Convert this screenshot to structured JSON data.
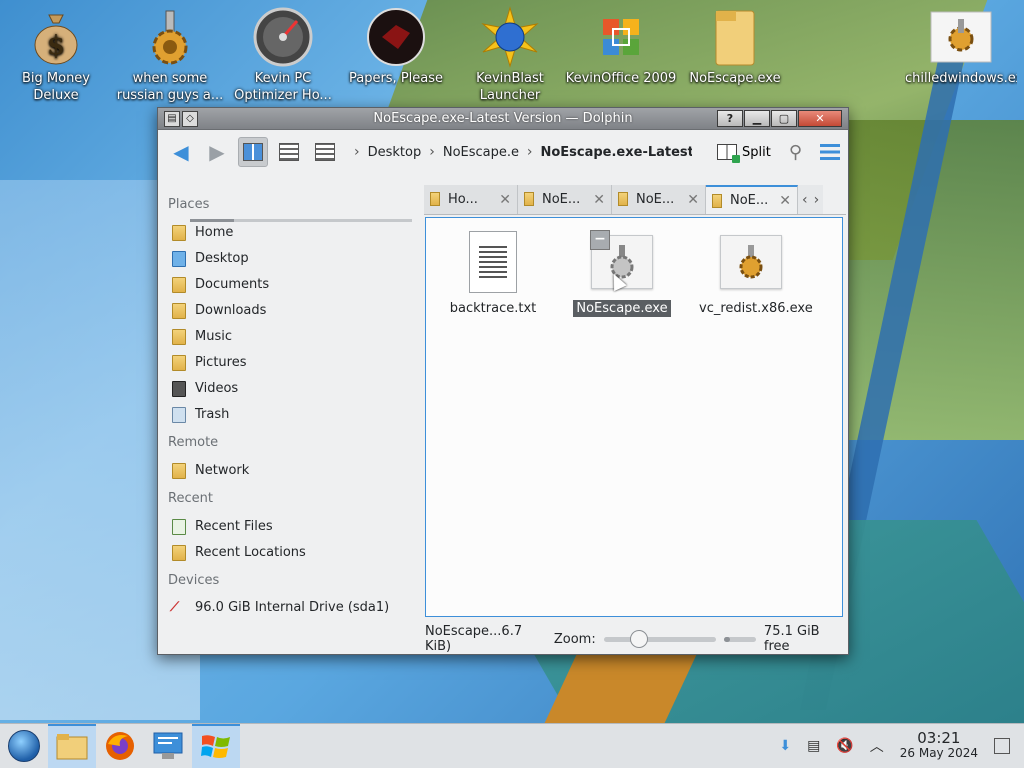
{
  "desktop": {
    "icons": [
      {
        "label": "Big Money Deluxe",
        "icon": "money-bag-icon"
      },
      {
        "label": "when some russian guys a...",
        "icon": "gear-icon"
      },
      {
        "label": "Kevin PC Optimizer Ho...",
        "icon": "speedometer-icon"
      },
      {
        "label": "Papers, Please",
        "icon": "papers-please-icon"
      },
      {
        "label": "KevinBlast Launcher",
        "icon": "globe-burst-icon"
      },
      {
        "label": "KevinOffice 2009",
        "icon": "office-logo-icon"
      },
      {
        "label": "NoEscape.exe",
        "icon": "folder-icon"
      },
      {
        "label": "chilledwindows.exe",
        "icon": "gear-icon"
      }
    ]
  },
  "window": {
    "title": "NoEscape.exe-Latest Version — Dolphin",
    "toolbar": {
      "breadcrumb": [
        "Desktop",
        "NoEscape.exe",
        "NoEscape.exe-Latest Version"
      ],
      "split_label": "Split"
    },
    "places": {
      "sections": {
        "places": "Places",
        "remote": "Remote",
        "recent": "Recent",
        "devices": "Devices"
      },
      "items": [
        "Home",
        "Desktop",
        "Documents",
        "Downloads",
        "Music",
        "Pictures",
        "Videos",
        "Trash"
      ],
      "remote": [
        "Network"
      ],
      "recent": [
        "Recent Files",
        "Recent Locations"
      ],
      "devices": [
        "96.0 GiB Internal Drive (sda1)"
      ]
    },
    "tabs": [
      {
        "label": "Ho..."
      },
      {
        "label": "NoE..."
      },
      {
        "label": "NoE..."
      },
      {
        "label": "NoE...",
        "active": true
      }
    ],
    "files": [
      {
        "name": "backtrace.txt",
        "icon": "text-file-icon",
        "selected": false
      },
      {
        "name": "NoEscape.exe",
        "icon": "gear-exe-icon",
        "selected": true
      },
      {
        "name": "vc_redist.x86.exe",
        "icon": "gear-exe-icon",
        "selected": false
      }
    ],
    "status": {
      "selection": "NoEscape...6.7 KiB)",
      "zoom_label": "Zoom:",
      "free_space": "75.1 GiB free"
    }
  },
  "taskbar": {
    "clock_time": "03:21",
    "clock_date": "26 May 2024",
    "tasks": [
      "start-orb",
      "file-manager",
      "firefox",
      "system-settings",
      "windows-logo"
    ]
  },
  "colors": {
    "accent": "#3d8fd9",
    "selection": "#5a5e62",
    "folder": "#e1b24a"
  }
}
